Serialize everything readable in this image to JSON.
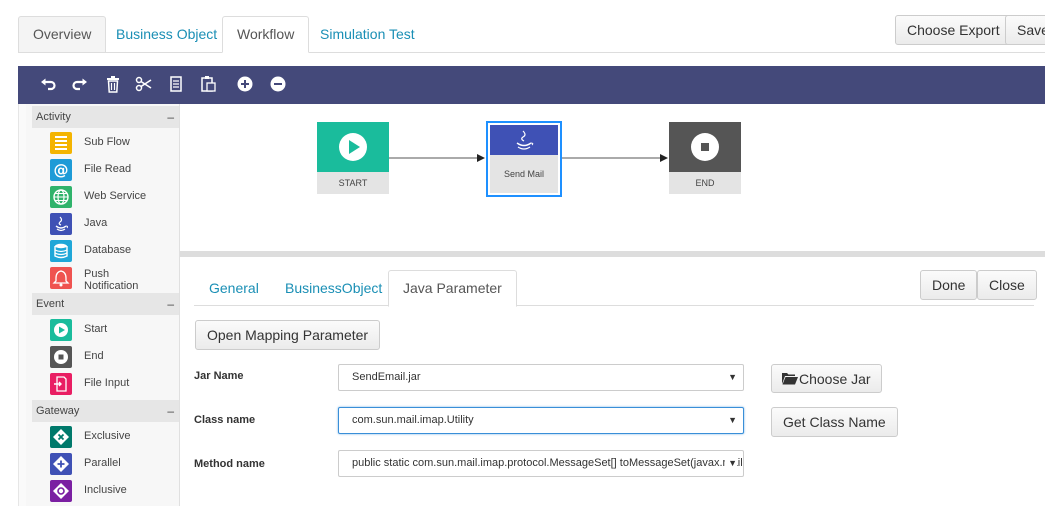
{
  "top_tabs": [
    "Overview",
    "Business Object",
    "Workflow",
    "Simulation Test"
  ],
  "top_buttons": {
    "choose_export": "Choose Export",
    "save": "Save"
  },
  "toolbar": [
    "undo-icon",
    "redo-icon",
    "trash-icon",
    "cut-icon",
    "copy-icon",
    "paste-icon",
    "add-icon",
    "remove-icon"
  ],
  "palette": {
    "sections": [
      {
        "title": "Activity",
        "collapse": "–",
        "items": [
          {
            "label": "Sub Flow",
            "icon": "subflow-icon",
            "color": "#f4b400"
          },
          {
            "label": "File Read",
            "icon": "at-icon",
            "color": "#1e9bd7"
          },
          {
            "label": "Web Service",
            "icon": "globe-icon",
            "color": "#2fb36b"
          },
          {
            "label": "Java",
            "icon": "java-icon",
            "color": "#3f51b5"
          },
          {
            "label": "Database",
            "icon": "database-icon",
            "color": "#1fa7d8"
          },
          {
            "label": "Push\nNotification",
            "icon": "bell-icon",
            "color": "#ef5350"
          }
        ]
      },
      {
        "title": "Event",
        "collapse": "–",
        "items": [
          {
            "label": "Start",
            "icon": "start-icon",
            "color": "#1abc9c"
          },
          {
            "label": "End",
            "icon": "end-icon",
            "color": "#555555"
          },
          {
            "label": "File Input",
            "icon": "file-input-icon",
            "color": "#e91e63"
          }
        ]
      },
      {
        "title": "Gateway",
        "collapse": "–",
        "items": [
          {
            "label": "Exclusive",
            "icon": "exclusive-icon",
            "color": "#00796b"
          },
          {
            "label": "Parallel",
            "icon": "parallel-icon",
            "color": "#3f51b5"
          },
          {
            "label": "Inclusive",
            "icon": "inclusive-icon",
            "color": "#7b1fa2"
          }
        ]
      }
    ]
  },
  "workflow": {
    "nodes": [
      {
        "label": "START",
        "icon": "play-icon",
        "color": "#1abc9c"
      },
      {
        "label": "Send Mail",
        "icon": "java-icon",
        "color": "#3f51b5"
      },
      {
        "label": "END",
        "icon": "stop-icon",
        "color": "#555555"
      }
    ]
  },
  "properties": {
    "tabs": [
      "General",
      "BusinessObject",
      "Java Parameter"
    ],
    "done": "Done",
    "close": "Close",
    "open_mapping": "Open Mapping Parameter",
    "jar": {
      "label": "Jar Name",
      "value": "SendEmail.jar",
      "button": "Choose Jar"
    },
    "class": {
      "label": "Class name",
      "value": "com.sun.mail.imap.Utility",
      "button": "Get Class Name"
    },
    "method": {
      "label": "Method name",
      "value": "public static com.sun.mail.imap.protocol.MessageSet[] toMessageSet(javax.mail.Message[], javax.mail.FetchProfile.Item)"
    }
  }
}
